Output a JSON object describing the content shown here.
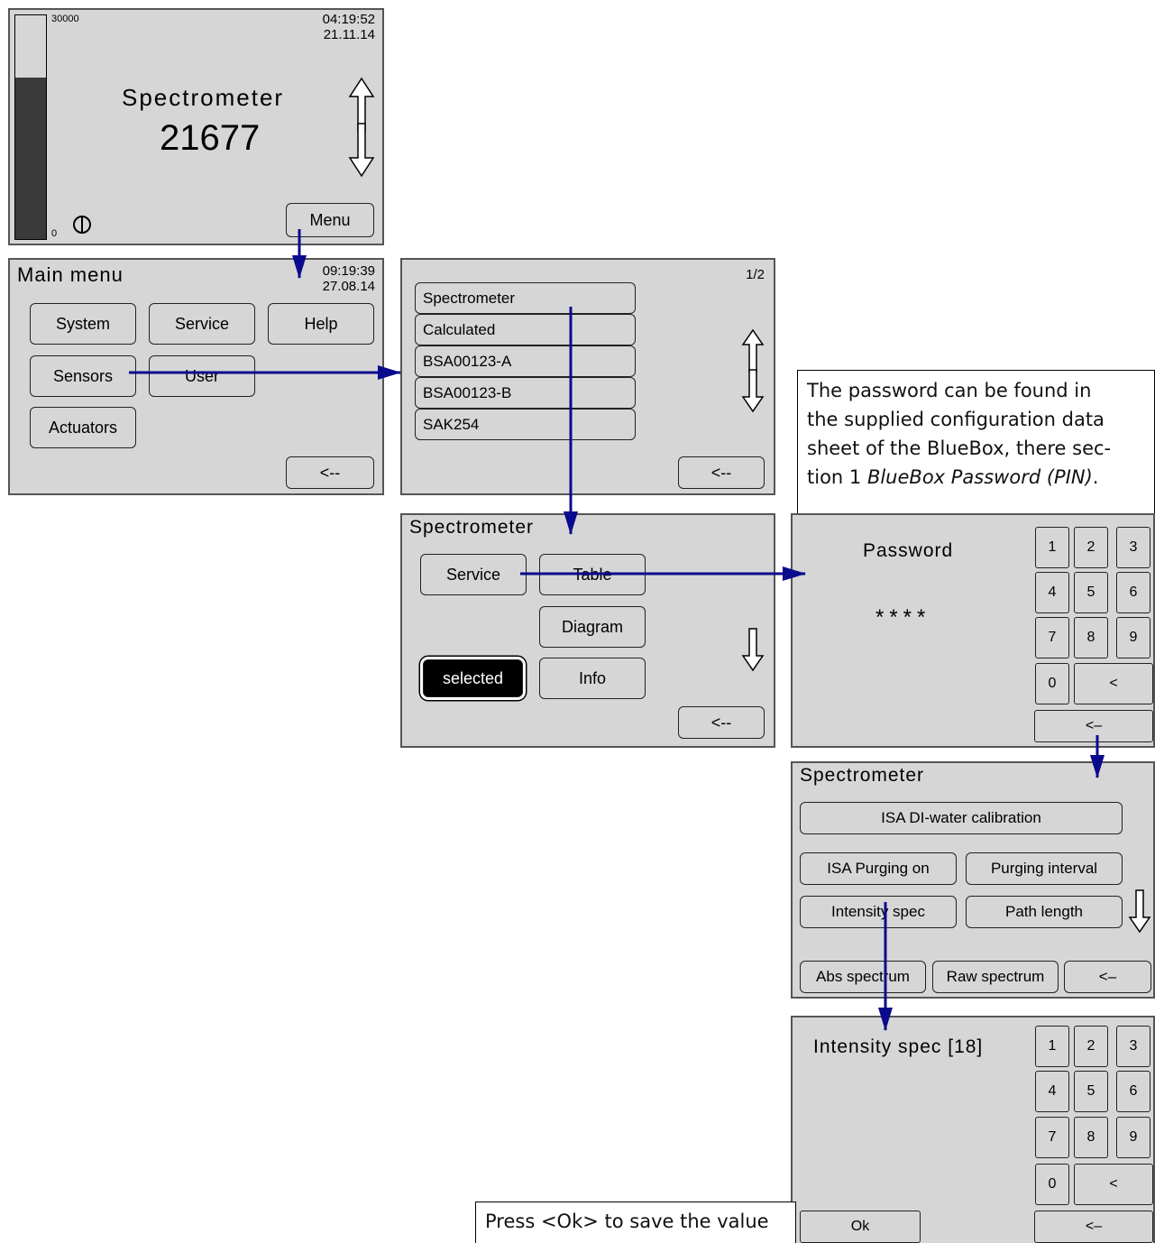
{
  "home": {
    "bar_max": "30000",
    "bar_min": "0",
    "bar_fill_fraction": 0.72,
    "time": "04:19:52",
    "date": "21.11.14",
    "title": "Spectrometer",
    "value": "21677",
    "menu_label": "Menu"
  },
  "main_menu": {
    "title": "Main menu",
    "time": "09:19:39",
    "date": "27.08.14",
    "system": "System",
    "service": "Service",
    "help": "Help",
    "sensors": "Sensors",
    "user": "User",
    "actuators": "Actuators",
    "back": "<--"
  },
  "sensor_list": {
    "page": "1/2",
    "items": [
      "Spectrometer",
      "Calculated",
      "BSA00123-A",
      "BSA00123-B",
      "SAK254"
    ],
    "back": "<--"
  },
  "spectrometer_menu": {
    "title": "Spectrometer",
    "service": "Service",
    "table": "Table",
    "diagram": "Diagram",
    "selected": "selected",
    "info": "Info",
    "back": "<--"
  },
  "password": {
    "label": "Password",
    "masked": "****",
    "keys": [
      "1",
      "2",
      "3",
      "4",
      "5",
      "6",
      "7",
      "8",
      "9",
      "0",
      "<"
    ],
    "back": "<–"
  },
  "service_menu": {
    "title": "Spectrometer",
    "isa_di": "ISA DI-water calibration",
    "isa_purging": "ISA Purging on",
    "purging_interval": "Purging interval",
    "intensity_spec": "Intensity spec",
    "path_length": "Path length",
    "abs_spectrum": "Abs spectrum",
    "raw_spectrum": "Raw spectrum",
    "back": "<–"
  },
  "intensity_entry": {
    "label": "Intensity spec [18]",
    "keys": [
      "1",
      "2",
      "3",
      "4",
      "5",
      "6",
      "7",
      "8",
      "9",
      "0",
      "<"
    ],
    "ok": "Ok",
    "back": "<–"
  },
  "notes": {
    "password_line1": "The password can be found in",
    "password_line2": "the supplied configuration data",
    "password_line3": "sheet of the BlueBox, there sec-",
    "password_line4_prefix": "tion 1 ",
    "password_line4_em": "BlueBox Password (PIN)",
    "password_line4_suffix": ".",
    "ok_note": "Press <Ok> to save the value"
  },
  "colors": {
    "panel": "#d6d6d6",
    "arrow": "#0a0a8c",
    "bar_fill": "#3a3a3a"
  }
}
